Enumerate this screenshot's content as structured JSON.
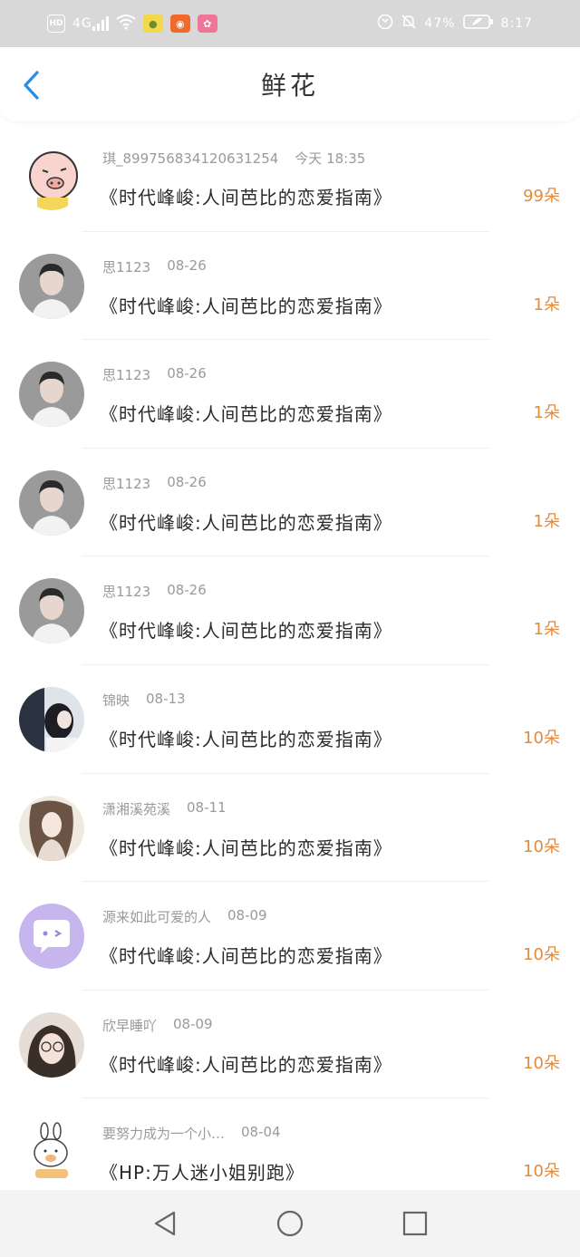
{
  "status_bar": {
    "left_icons": [
      "hd-icon",
      "signal-4g-icon",
      "wifi-icon",
      "app-notification-icon",
      "app-notification-icon",
      "app-notification-icon"
    ],
    "hd_label": "HD",
    "network_label": "4G",
    "battery_percent": "47%",
    "time": "8:17"
  },
  "header": {
    "title": "鲜花",
    "back_icon": "chevron-left-icon"
  },
  "colors": {
    "accent_blue": "#2b8be9",
    "count_orange": "#e58a3a",
    "meta_gray": "#9a9a9a",
    "status_bar_bg": "#d8d8d8"
  },
  "items": [
    {
      "user": "琪_8997568341206312​54",
      "time": "今天 18:35",
      "book": "《时代峰峻:人间芭比的恋爱指南》",
      "count": "99朵",
      "avatar": "cartoon-pig-avatar"
    },
    {
      "user": "思1123",
      "time": "08-26",
      "book": "《时代峰峻:人间芭比的恋爱指南》",
      "count": "1朵",
      "avatar": "person-photo-avatar"
    },
    {
      "user": "思1123",
      "time": "08-26",
      "book": "《时代峰峻:人间芭比的恋爱指南》",
      "count": "1朵",
      "avatar": "person-photo-avatar"
    },
    {
      "user": "思1123",
      "time": "08-26",
      "book": "《时代峰峻:人间芭比的恋爱指南》",
      "count": "1朵",
      "avatar": "person-photo-avatar"
    },
    {
      "user": "思1123",
      "time": "08-26",
      "book": "《时代峰峻:人间芭比的恋爱指南》",
      "count": "1朵",
      "avatar": "person-photo-avatar"
    },
    {
      "user": "锦映",
      "time": "08-13",
      "book": "《时代峰峻:人间芭比的恋爱指南》",
      "count": "10朵",
      "avatar": "photo-avatar-dark"
    },
    {
      "user": "潇湘溪苑溪",
      "time": "08-11",
      "book": "《时代峰峻:人间芭比的恋爱指南》",
      "count": "10朵",
      "avatar": "illustration-avatar"
    },
    {
      "user": "源来如此可爱的人",
      "time": "08-09",
      "book": "《时代峰峻:人间芭比的恋爱指南》",
      "count": "10朵",
      "avatar": "chat-bubble-avatar"
    },
    {
      "user": "欣早睡吖",
      "time": "08-09",
      "book": "《时代峰峻:人间芭比的恋爱指南》",
      "count": "10朵",
      "avatar": "girl-photo-avatar"
    },
    {
      "user": "要努力成为一个小…",
      "time": "08-04",
      "book": "《HP:万人迷小姐别跑》",
      "count": "10朵",
      "avatar": "cartoon-bunny-avatar"
    }
  ],
  "nav_bar": {
    "buttons": [
      "back-triangle-icon",
      "home-circle-icon",
      "recents-square-icon"
    ]
  }
}
